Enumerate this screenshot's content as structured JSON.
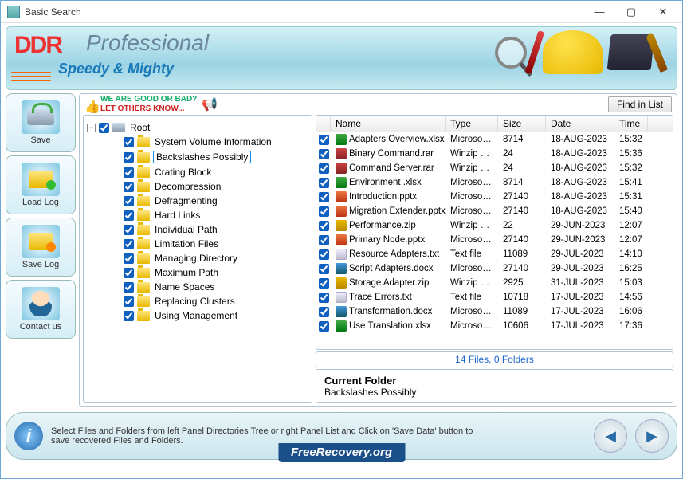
{
  "window": {
    "title": "Basic Search"
  },
  "banner": {
    "brand": "DDR",
    "product": "Professional",
    "tagline": "Speedy & Mighty"
  },
  "sidebar": {
    "items": [
      {
        "label": "Save"
      },
      {
        "label": "Load Log"
      },
      {
        "label": "Save Log"
      },
      {
        "label": "Contact us"
      }
    ]
  },
  "toolbar": {
    "feedback_line1": "WE ARE GOOD OR BAD?",
    "feedback_line2": "LET OTHERS KNOW...",
    "find_label": "Find in List"
  },
  "tree": {
    "root_label": "Root",
    "items": [
      {
        "label": "System Volume Information",
        "selected": false
      },
      {
        "label": "Backslashes Possibly",
        "selected": true
      },
      {
        "label": "Crating Block",
        "selected": false
      },
      {
        "label": "Decompression",
        "selected": false
      },
      {
        "label": "Defragmenting",
        "selected": false
      },
      {
        "label": "Hard Links",
        "selected": false
      },
      {
        "label": "Individual Path",
        "selected": false
      },
      {
        "label": "Limitation Files",
        "selected": false
      },
      {
        "label": "Managing Directory",
        "selected": false
      },
      {
        "label": "Maximum Path",
        "selected": false
      },
      {
        "label": "Name Spaces",
        "selected": false
      },
      {
        "label": "Replacing Clusters",
        "selected": false
      },
      {
        "label": "Using Management",
        "selected": false
      }
    ]
  },
  "list": {
    "columns": {
      "name": "Name",
      "type": "Type",
      "size": "Size",
      "date": "Date",
      "time": "Time"
    },
    "rows": [
      {
        "name": "Adapters Overview.xlsx",
        "type": "Microsoft...",
        "size": "8714",
        "date": "18-AUG-2023",
        "time": "15:32",
        "ico": "xlsx"
      },
      {
        "name": "Binary Command.rar",
        "type": "Winzip File",
        "size": "24",
        "date": "18-AUG-2023",
        "time": "15:36",
        "ico": "rar"
      },
      {
        "name": "Command Server.rar",
        "type": "Winzip File",
        "size": "24",
        "date": "18-AUG-2023",
        "time": "15:32",
        "ico": "rar"
      },
      {
        "name": "Environment .xlsx",
        "type": "Microsoft...",
        "size": "8714",
        "date": "18-AUG-2023",
        "time": "15:41",
        "ico": "xlsx"
      },
      {
        "name": "Introduction.pptx",
        "type": "Microsoft...",
        "size": "27140",
        "date": "18-AUG-2023",
        "time": "15:31",
        "ico": "pptx"
      },
      {
        "name": "Migration Extender.pptx",
        "type": "Microsoft...",
        "size": "27140",
        "date": "18-AUG-2023",
        "time": "15:40",
        "ico": "pptx"
      },
      {
        "name": "Performance.zip",
        "type": "Winzip File",
        "size": "22",
        "date": "29-JUN-2023",
        "time": "12:07",
        "ico": "zip"
      },
      {
        "name": "Primary Node.pptx",
        "type": "Microsoft...",
        "size": "27140",
        "date": "29-JUN-2023",
        "time": "12:07",
        "ico": "pptx"
      },
      {
        "name": "Resource Adapters.txt",
        "type": "Text file",
        "size": "11089",
        "date": "29-JUL-2023",
        "time": "14:10",
        "ico": "txt"
      },
      {
        "name": "Script Adapters.docx",
        "type": "Microsoft...",
        "size": "27140",
        "date": "29-JUL-2023",
        "time": "16:25",
        "ico": "docx"
      },
      {
        "name": "Storage Adapter.zip",
        "type": "Winzip File",
        "size": "2925",
        "date": "31-JUL-2023",
        "time": "15:03",
        "ico": "zip"
      },
      {
        "name": "Trace Errors.txt",
        "type": "Text file",
        "size": "10718",
        "date": "17-JUL-2023",
        "time": "14:56",
        "ico": "txt"
      },
      {
        "name": "Transformation.docx",
        "type": "Microsoft...",
        "size": "11089",
        "date": "17-JUL-2023",
        "time": "16:06",
        "ico": "docx"
      },
      {
        "name": "Use Translation.xlsx",
        "type": "Microsoft...",
        "size": "10606",
        "date": "17-JUL-2023",
        "time": "17:36",
        "ico": "xlsx"
      }
    ]
  },
  "status": {
    "text": "14 Files, 0 Folders"
  },
  "current_folder": {
    "heading": "Current Folder",
    "value": "Backslashes Possibly"
  },
  "footer": {
    "hint": "Select Files and Folders from left Panel Directories Tree or right Panel List and Click on 'Save Data' button to save recovered Files and Folders.",
    "site": "FreeRecovery.org"
  }
}
